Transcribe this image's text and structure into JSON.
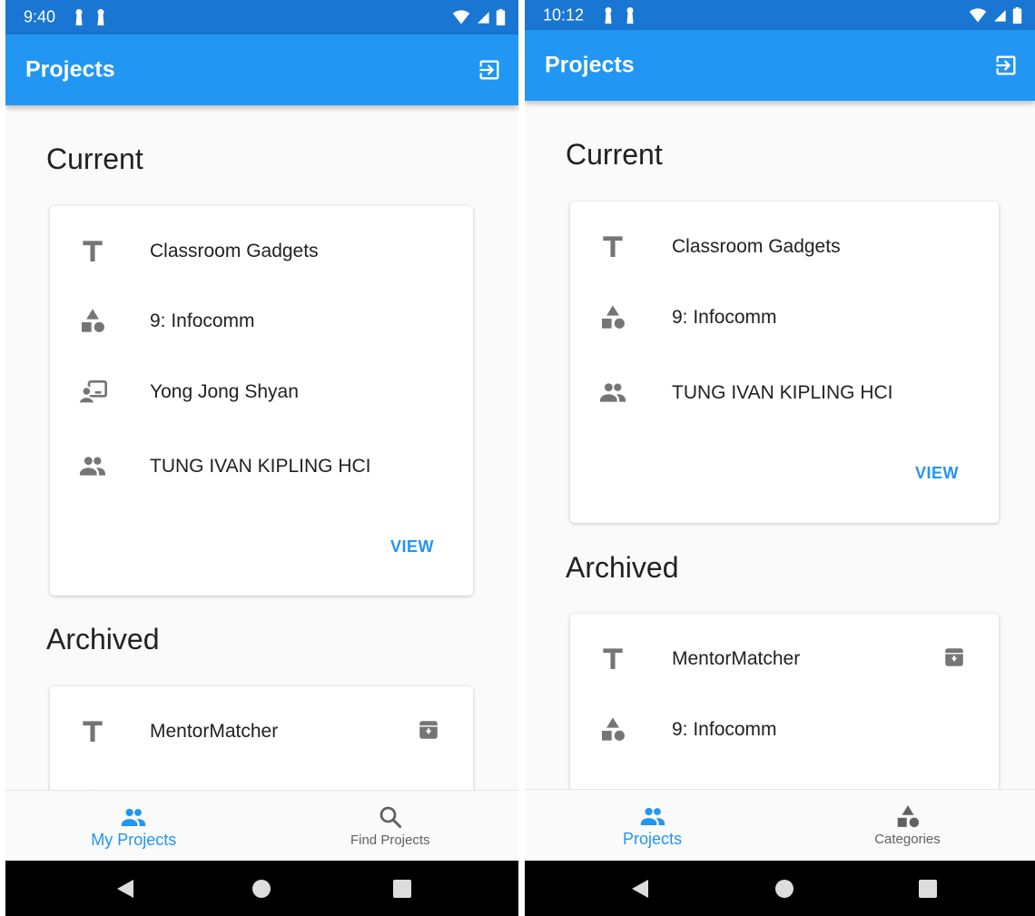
{
  "colors": {
    "primary": "#2196f3",
    "status_bar": "#1976d2",
    "icon_grey": "#757575",
    "text": "#212121"
  },
  "left_screen": {
    "status_bar": {
      "time": "9:40"
    },
    "app_bar": {
      "title": "Projects",
      "action_icon": "exit-to-app-icon"
    },
    "current": {
      "heading": "Current",
      "rows": [
        {
          "icon": "title-icon",
          "text": "Classroom Gadgets"
        },
        {
          "icon": "category-icon",
          "text": "9: Infocomm"
        },
        {
          "icon": "supervisor-icon",
          "text": "Yong Jong Shyan"
        },
        {
          "icon": "people-icon",
          "text": "TUNG IVAN KIPLING HCI"
        }
      ],
      "action": "VIEW"
    },
    "archived": {
      "heading": "Archived",
      "rows": [
        {
          "icon": "title-icon",
          "text": "MentorMatcher",
          "badge_icon": "unarchive-icon"
        }
      ]
    },
    "bottom_nav": [
      {
        "label": "My Projects",
        "icon": "people-icon",
        "active": true
      },
      {
        "label": "Find Projects",
        "icon": "search-icon",
        "active": false
      }
    ]
  },
  "right_screen": {
    "status_bar": {
      "time": "10:12"
    },
    "app_bar": {
      "title": "Projects",
      "action_icon": "exit-to-app-icon"
    },
    "current": {
      "heading": "Current",
      "rows": [
        {
          "icon": "title-icon",
          "text": "Classroom Gadgets"
        },
        {
          "icon": "category-icon",
          "text": "9: Infocomm"
        },
        {
          "icon": "people-icon",
          "text": "TUNG IVAN KIPLING HCI"
        }
      ],
      "action": "VIEW"
    },
    "archived": {
      "heading": "Archived",
      "rows": [
        {
          "icon": "title-icon",
          "text": "MentorMatcher",
          "badge_icon": "unarchive-icon"
        },
        {
          "icon": "category-icon",
          "text": "9: Infocomm"
        }
      ]
    },
    "bottom_nav": [
      {
        "label": "Projects",
        "icon": "people-icon",
        "active": true
      },
      {
        "label": "Categories",
        "icon": "category-icon",
        "active": false
      }
    ]
  }
}
